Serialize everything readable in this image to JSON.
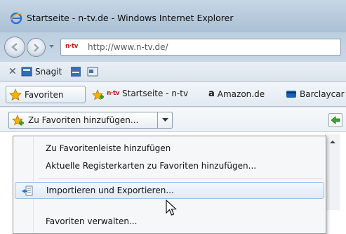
{
  "window": {
    "title": "Startseite - n-tv.de - Windows Internet Explorer"
  },
  "address": {
    "favicon_text": "n·tv",
    "url": "http://www.n-tv.de/"
  },
  "toolbar": {
    "snagit_label": "Snagit"
  },
  "favorites_bar": {
    "favorites_label": "Favoriten",
    "links": [
      {
        "logo": "n·tv",
        "label": "Startseite - n-tv"
      },
      {
        "logo": "a",
        "label": "Amazon.de"
      },
      {
        "logo": "",
        "label": "Barclaycar"
      }
    ]
  },
  "favorites_panel": {
    "add_label": "Zu Favoriten hinzufügen..."
  },
  "menu": {
    "items": [
      {
        "label": "Zu Favoritenleiste hinzufügen"
      },
      {
        "label": "Aktuelle Registerkarten zu Favoriten hinzufügen..."
      },
      {
        "label": "Importieren und Exportieren..."
      },
      {
        "label": "Favoriten verwalten..."
      }
    ]
  },
  "colors": {
    "ntv_red": "#c21a1a",
    "highlight": "#dfeaf8",
    "favorites_star": "#f4b400"
  }
}
